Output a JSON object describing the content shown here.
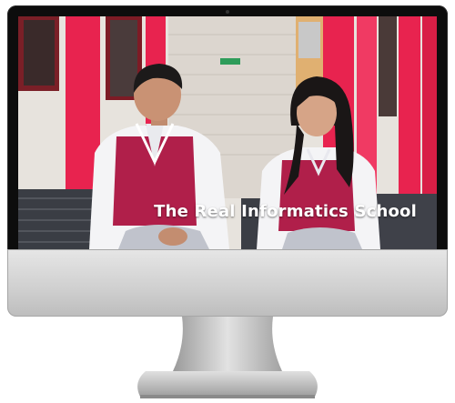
{
  "video": {
    "title_overlay": "The Real Informatics School"
  },
  "colors": {
    "uniform_red": "#b01f4a",
    "pillar_pink": "#e8234f",
    "bezel_black": "#0d0d0d",
    "chin_silver": "#d3d3d3"
  }
}
